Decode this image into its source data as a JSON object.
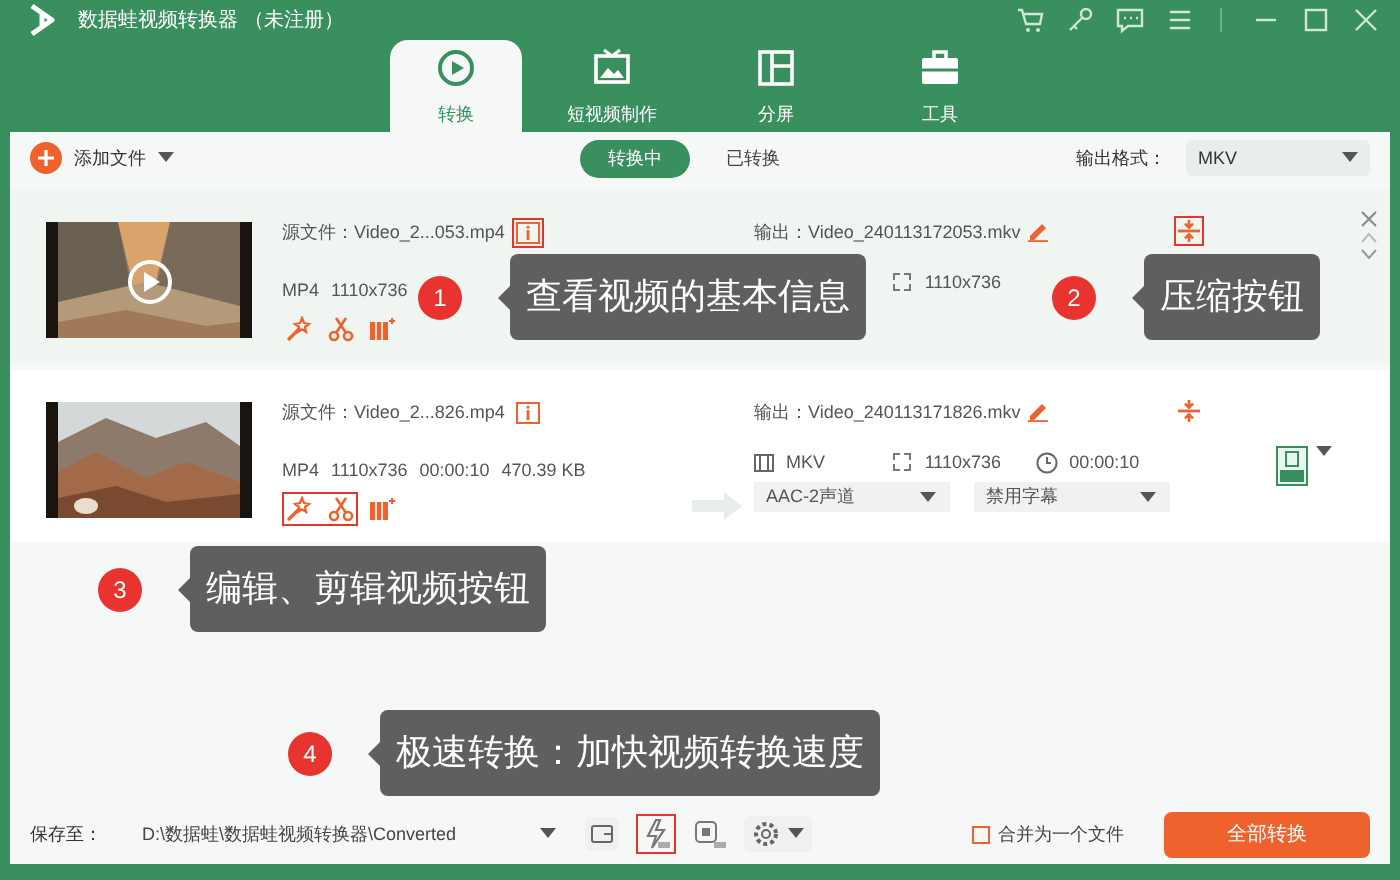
{
  "window": {
    "title": "数据蛙视频转换器 （未注册）"
  },
  "tabs": [
    {
      "label": "转换",
      "kind": "convert",
      "selected": true
    },
    {
      "label": "短视频制作",
      "kind": "tv",
      "selected": false
    },
    {
      "label": "分屏",
      "kind": "split",
      "selected": false
    },
    {
      "label": "工具",
      "kind": "toolbox",
      "selected": false
    }
  ],
  "toolbar": {
    "add_button": "添加文件",
    "filters": [
      {
        "label": "转换中",
        "selected": true
      },
      {
        "label": "已转换",
        "selected": false
      }
    ],
    "output_format_label": "输出格式：",
    "output_format": "MKV"
  },
  "files": [
    {
      "source": "源文件：Video_2...053.mp4",
      "specs": [
        "MP4",
        "1110x736"
      ],
      "output": "输出：Video_240113172053.mkv",
      "out_resolution": "1110x736",
      "selected": true,
      "info_highlighted": true,
      "compress_highlighted": true,
      "edit_highlighted": false
    },
    {
      "source": "源文件：Video_2...826.mp4",
      "specs": [
        "MP4",
        "1110x736",
        "00:00:10",
        "470.39 KB"
      ],
      "output": "输出：Video_240113171826.mkv",
      "out_format": "MKV",
      "out_resolution": "1110x736",
      "out_duration": "00:00:10",
      "audio": "AAC-2声道",
      "subtitle": "禁用字幕",
      "selected": false,
      "info_highlighted": false,
      "compress_highlighted": false,
      "edit_highlighted": true
    }
  ],
  "callouts": [
    {
      "number": "1",
      "text": "查看视频的基本信息"
    },
    {
      "number": "2",
      "text": "压缩按钮"
    },
    {
      "number": "3",
      "text": "编辑、剪辑视频按钮"
    },
    {
      "number": "4",
      "text": "极速转换：加快视频转换速度"
    }
  ],
  "bottom_bar": {
    "save_label": "保存至：",
    "path": "D:\\数据蛙\\数据蛙视频转换器\\Converted",
    "turbo_highlighted": true,
    "merge": {
      "label": "合并为一个文件",
      "checked": false
    },
    "convert_all": "全部转换"
  }
}
